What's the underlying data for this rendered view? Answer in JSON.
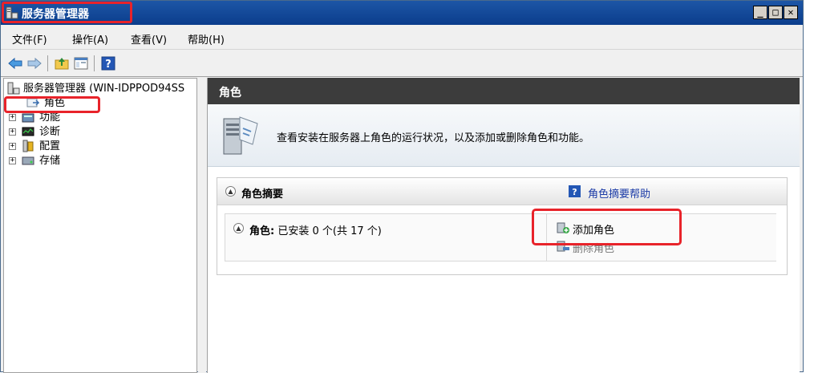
{
  "window": {
    "title": "服务器管理器",
    "controls": [
      "_",
      "□",
      "✕"
    ]
  },
  "menu": {
    "items": [
      "文件(F)",
      "操作(A)",
      "查看(V)",
      "帮助(H)"
    ]
  },
  "toolbar": {
    "buttons": [
      "back-arrow-icon",
      "forward-arrow-icon",
      "up-folder-icon",
      "show-hide-console-tree-icon",
      "help-icon"
    ]
  },
  "tree": {
    "root_label": "服务器管理器 (WIN-IDPPOD94SS",
    "items": [
      {
        "label": "角色",
        "icon": "roles-icon",
        "selected": true
      },
      {
        "label": "功能",
        "icon": "features-icon",
        "expander": "+"
      },
      {
        "label": "诊断",
        "icon": "diagnostics-icon",
        "expander": "+"
      },
      {
        "label": "配置",
        "icon": "configuration-icon",
        "expander": "+"
      },
      {
        "label": "存储",
        "icon": "storage-icon",
        "expander": "+"
      }
    ]
  },
  "content": {
    "header_title": "角色",
    "intro_text": "查看安装在服务器上角色的运行状况，以及添加或删除角色和功能。",
    "section": {
      "title": "角色摘要",
      "help_link": "角色摘要帮助",
      "roles_label": "角色:",
      "roles_status": "已安装 0 个(共 17 个)",
      "actions": {
        "add_role": "添加角色",
        "remove_role": "删除角色"
      }
    }
  },
  "colors": {
    "highlight": "#e8232a",
    "titlebar": "#0b3d8c",
    "content_header": "#3c3c3c",
    "link": "#1a3aa6"
  }
}
